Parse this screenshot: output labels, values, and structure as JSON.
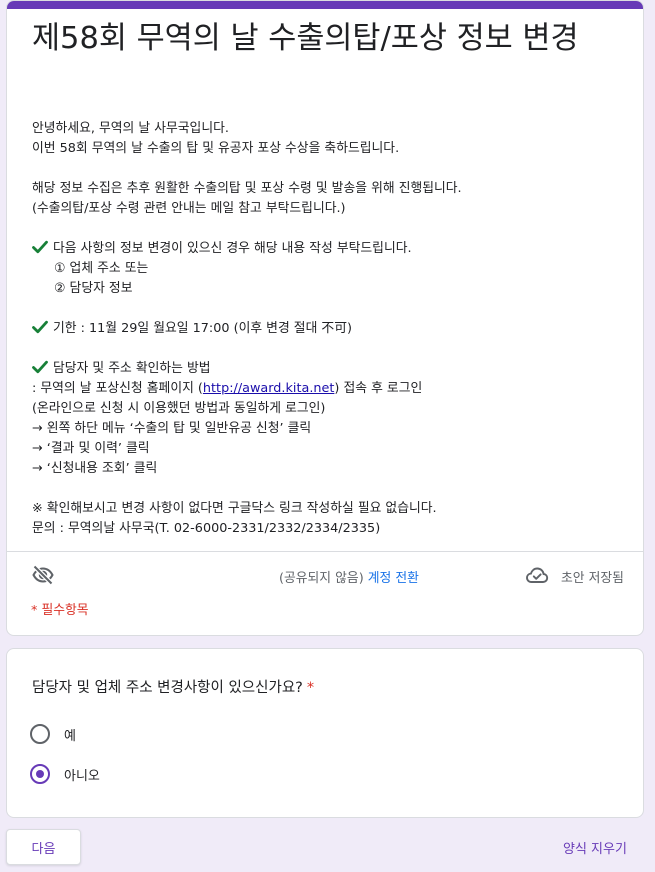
{
  "form": {
    "title": "제58회 무역의 날 수출의탑/포상 정보 변경",
    "description": {
      "greeting": "안녕하세요, 무역의 날 사무국입니다.",
      "congrats": "이번 58회 무역의 날 수출의 탑 및 유공자 포상 수상을 축하드립니다.",
      "purpose": "해당 정보 수집은 추후 원활한 수출의탑 및 포상 수령 및 발송을 위해 진행됩니다.",
      "purpose_note": "(수출의탑/포상 수령 관련 안내는 메일 참고 부탁드립니다.)",
      "check1": "다음 사항의 정보 변경이 있으신 경우 해당 내용 작성 부탁드립니다.",
      "check1_item1": "① 업체 주소  또는",
      "check1_item2": "② 담당자 정보",
      "check2": "기한 :  11월 29일 월요일 17:00 (이후 변경 절대 不可)",
      "check3": "담당자 및 주소 확인하는 방법",
      "method_line1_pre": ": 무역의 날 포상신청 홈페이지 (",
      "method_link": "http://award.kita.net",
      "method_line1_post": ") 접속 후 로그인",
      "method_line2": "(온라인으로 신청 시 이용했던 방법과 동일하게 로그인)",
      "method_line3": "→ 왼쪽 하단 메뉴 ‘수출의 탑 및 일반유공 신청’ 클릭",
      "method_line4": "→ ‘결과 및 이력’ 클릭",
      "method_line5": "→ ‘신청내용 조회’ 클릭",
      "note": "※ 확인해보시고 변경 사항이 없다면 구글닥스 링크 작성하실 필요 없습니다.",
      "contact": "문의 : 무역의날 사무국(T. 02-6000-2331/2332/2334/2335)"
    },
    "account": {
      "status": "(공유되지 않음)",
      "switch_label": "계정 전환"
    },
    "draft_status": "초안 저장됨",
    "required_note": "* 필수항목"
  },
  "question": {
    "title": "담당자 및 업체 주소 변경사항이 있으신가요?",
    "required_mark": "*",
    "options": [
      {
        "label": "예",
        "selected": false
      },
      {
        "label": "아니오",
        "selected": true
      }
    ]
  },
  "footer": {
    "next_label": "다음",
    "clear_label": "양식 지우기"
  },
  "colors": {
    "accent": "#673ab7",
    "check": "#188038",
    "required": "#d93025",
    "link": "#1a73e8",
    "background": "#f0ebf8"
  },
  "icons": [
    "check-icon",
    "visibility-off-icon",
    "cloud-done-icon",
    "radio-icon"
  ]
}
